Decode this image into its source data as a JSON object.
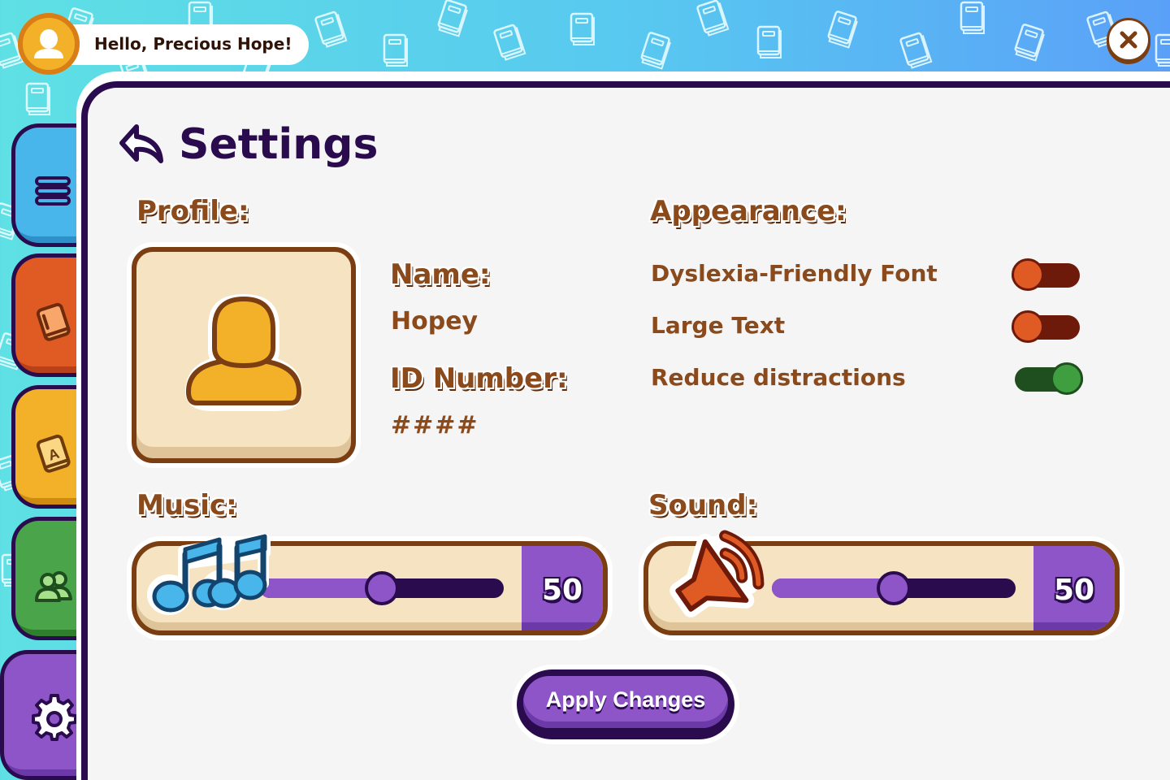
{
  "header": {
    "greeting": "Hello, Precious Hope!"
  },
  "page": {
    "title": "Settings"
  },
  "profile": {
    "heading": "Profile:",
    "name_label": "Name:",
    "name_value": "Hopey",
    "id_label": "ID Number:",
    "id_value": "####"
  },
  "appearance": {
    "heading": "Appearance:",
    "options": [
      {
        "label": "Dyslexia-Friendly Font",
        "enabled": false
      },
      {
        "label": "Large Text",
        "enabled": false
      },
      {
        "label": "Reduce distractions",
        "enabled": true
      }
    ]
  },
  "music": {
    "heading": "Music:",
    "value": "50",
    "level": 50
  },
  "sound": {
    "heading": "Sound:",
    "value": "50",
    "level": 50
  },
  "apply": {
    "label": "Apply Changes"
  },
  "sidebar": {
    "tabs": [
      "menu-icon",
      "book-icon",
      "dictionary-icon",
      "friends-icon",
      "gear-icon"
    ]
  },
  "colors": {
    "accent": "#8d55c7",
    "outline": "#2a0c4e",
    "text_brown": "#8b4a1c",
    "toggle_on": "#3f9e3f",
    "toggle_off": "#e05a24"
  }
}
